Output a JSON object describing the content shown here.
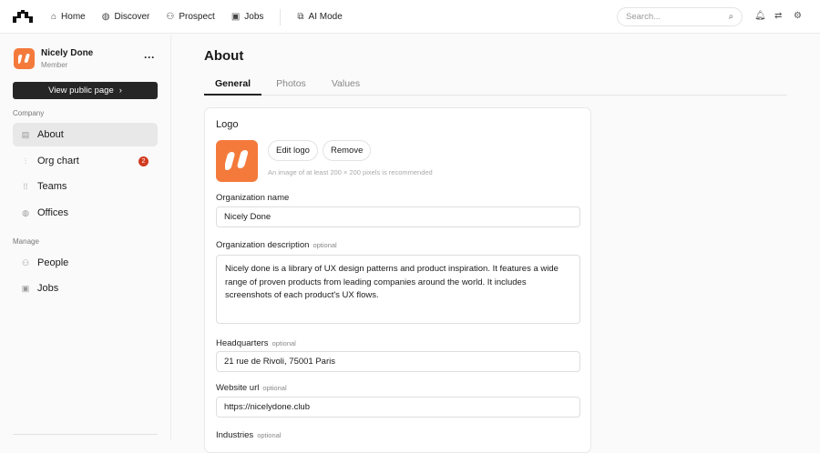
{
  "nav": {
    "items": [
      {
        "label": "Home",
        "icon": "home-icon"
      },
      {
        "label": "Discover",
        "icon": "globe-icon"
      },
      {
        "label": "Prospect",
        "icon": "users-icon"
      },
      {
        "label": "Jobs",
        "icon": "briefcase-icon"
      },
      {
        "label": "AI Mode",
        "icon": "ai-icon"
      }
    ],
    "search_placeholder": "Search..."
  },
  "org": {
    "name": "Nicely Done",
    "role": "Member",
    "view_public": "View public page",
    "menu": "···"
  },
  "sidebar": {
    "company_label": "Company",
    "manage_label": "Manage",
    "company": [
      {
        "label": "About"
      },
      {
        "label": "Org chart",
        "badge": "2"
      },
      {
        "label": "Teams"
      },
      {
        "label": "Offices"
      }
    ],
    "manage": [
      {
        "label": "People"
      },
      {
        "label": "Jobs"
      }
    ]
  },
  "page": {
    "title": "About",
    "tabs": [
      "General",
      "Photos",
      "Values"
    ]
  },
  "form": {
    "logo_label": "Logo",
    "edit_logo": "Edit logo",
    "remove": "Remove",
    "logo_hint": "An image of at least 200 × 200 pixels is recommended",
    "optional": "optional",
    "name_label": "Organization name",
    "name_value": "Nicely Done",
    "desc_label": "Organization description",
    "desc_value": "Nicely done is a library of UX design patterns and product inspiration. It features a wide range of proven products from leading companies around the world. It includes screenshots of each product's UX flows.",
    "hq_label": "Headquarters",
    "hq_value": "21 rue de Rivoli, 75001 Paris",
    "web_label": "Website url",
    "web_value": "https://nicelydone.club",
    "ind_label": "Industries"
  },
  "colors": {
    "brand": "#f47a3c",
    "badge": "#d13b20"
  }
}
